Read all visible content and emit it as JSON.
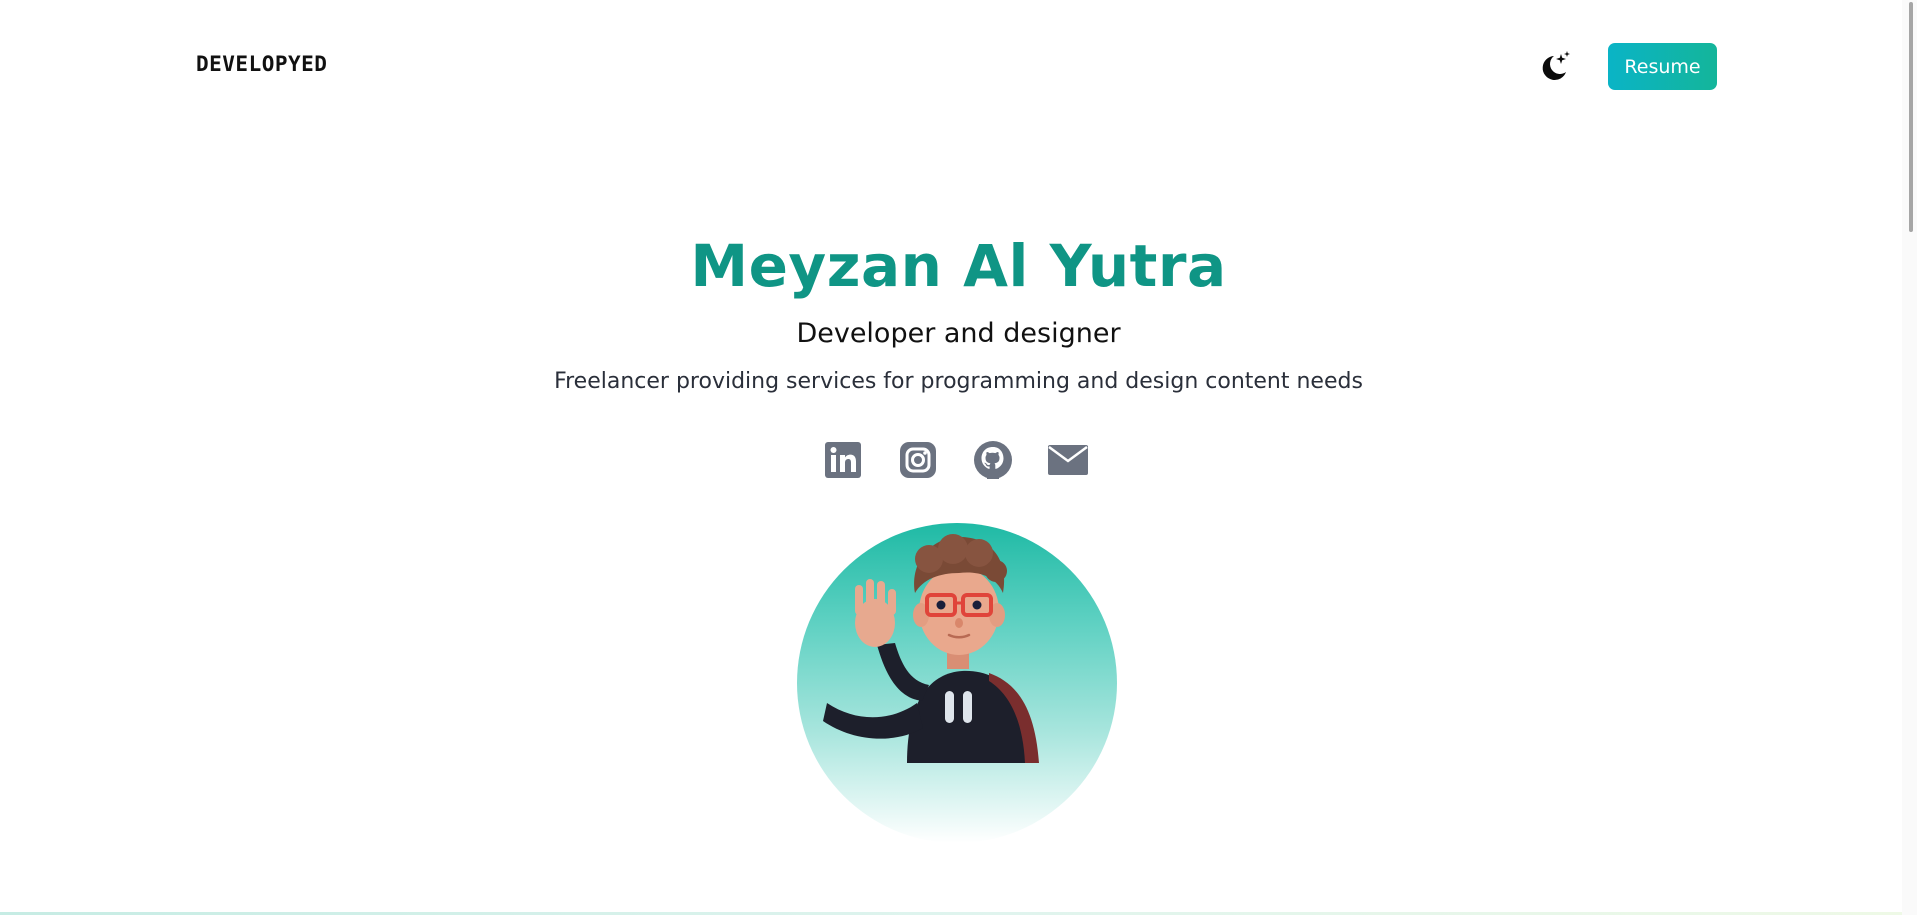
{
  "header": {
    "brand": "DEVELOPYED",
    "theme_toggle_icon": "moon-stars-icon",
    "resume_label": "Resume"
  },
  "hero": {
    "name": "Meyzan Al Yutra",
    "role": "Developer and designer",
    "description": "Freelancer providing services for programming and design content needs"
  },
  "socials": [
    {
      "icon": "linkedin-icon"
    },
    {
      "icon": "instagram-icon"
    },
    {
      "icon": "github-icon"
    },
    {
      "icon": "mail-icon"
    }
  ],
  "colors": {
    "accent": "#0f9585",
    "button_gradient_start": "#0ab4c6",
    "button_gradient_end": "#14b59a",
    "icon": "#6b7280"
  }
}
